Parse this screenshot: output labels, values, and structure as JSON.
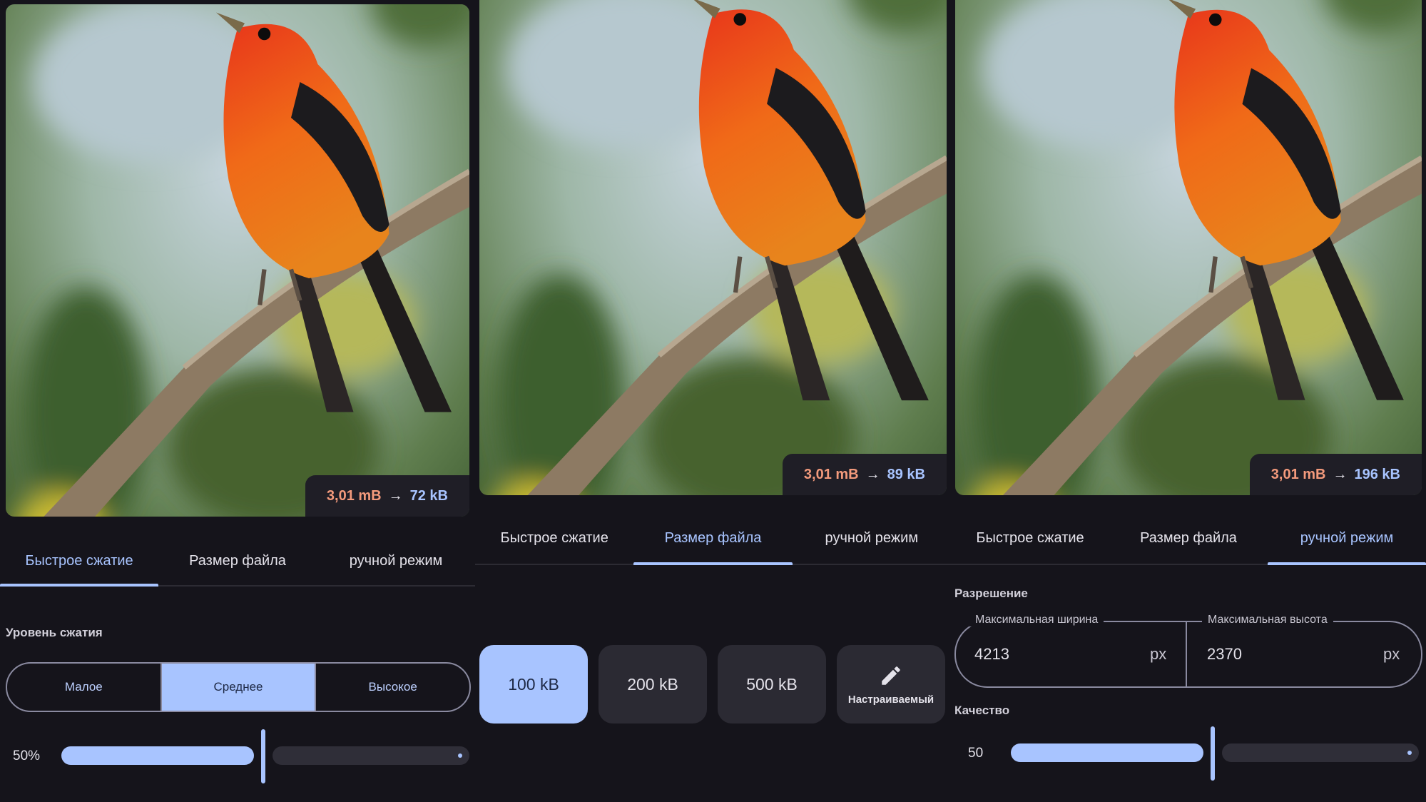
{
  "colors": {
    "accent": "#a8c4ff",
    "background": "#15141b",
    "size_from": "#f39a7c",
    "chip_bg": "#2b2a33"
  },
  "tabs": [
    "Быстрое сжатие",
    "Размер файла",
    "ручной режим"
  ],
  "screen1": {
    "badge": {
      "from": "3,01 mB",
      "arrow": "→",
      "to": "72 kB"
    },
    "section_label": "Уровень сжатия",
    "levels": [
      "Малое",
      "Среднее",
      "Высокое"
    ],
    "selected_level": "Среднее",
    "slider": {
      "value_label": "50%",
      "value": 0.5
    }
  },
  "screen2": {
    "badge": {
      "from": "3,01 mB",
      "arrow": "→",
      "to": "89 kB"
    },
    "chips": [
      "100 kB",
      "200 kB",
      "500 kB"
    ],
    "custom_chip": {
      "label": "Настраиваемый",
      "icon": "pencil-icon"
    },
    "selected_chip": "100 kB"
  },
  "screen3": {
    "badge": {
      "from": "3,01 mB",
      "arrow": "→",
      "to": "196 kB"
    },
    "resolution_label": "Разрешение",
    "width_field": {
      "caption": "Максимальная ширина",
      "value": "4213",
      "unit": "px"
    },
    "height_field": {
      "caption": "Максимальная высота",
      "value": "2370",
      "unit": "px"
    },
    "quality_label": "Качество",
    "slider": {
      "value_label": "50",
      "value": 0.5
    }
  }
}
